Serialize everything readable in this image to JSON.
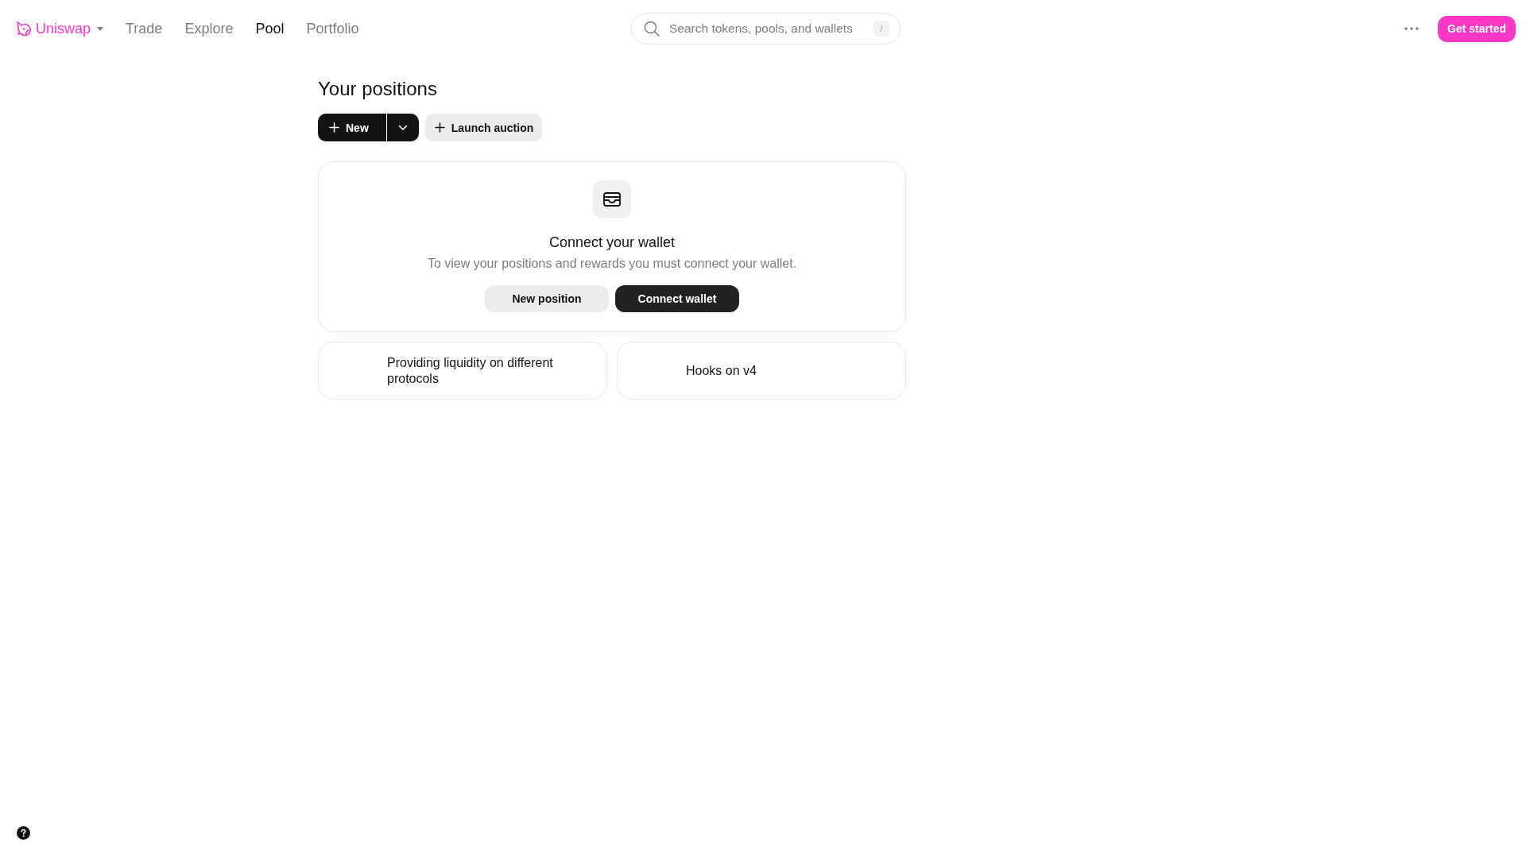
{
  "header": {
    "brand": {
      "label": "Uniswap"
    },
    "nav": [
      {
        "label": "Trade",
        "selected": false
      },
      {
        "label": "Explore",
        "selected": false
      },
      {
        "label": "Pool",
        "selected": true
      },
      {
        "label": "Portfolio",
        "selected": false
      }
    ],
    "search": {
      "placeholder": "Search tokens, pools, and wallets",
      "shortcut": "/"
    },
    "cta": "Get started"
  },
  "page": {
    "title": "Your positions",
    "actions": [
      {
        "kind": "split",
        "label": "New"
      },
      {
        "kind": "secondary",
        "label": "Launch auction"
      }
    ]
  },
  "wallet_card": {
    "title": "Connect your wallet",
    "text": "To view your positions and rewards you must connect your wallet.",
    "buttons": [
      {
        "kind": "secondary",
        "label": "New position"
      },
      {
        "kind": "primary",
        "label": "Connect wallet"
      }
    ]
  },
  "info_cards": [
    {
      "label": "Providing liquidity on different protocols"
    },
    {
      "label": "Hooks on v4"
    }
  ]
}
